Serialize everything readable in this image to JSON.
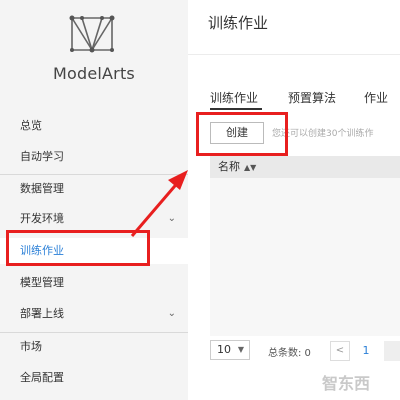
{
  "sidebar": {
    "brand": "ModelArts",
    "items": [
      {
        "label": "总览",
        "chevron": false,
        "active": false
      },
      {
        "label": "自动学习",
        "chevron": false,
        "active": false
      },
      {
        "label": "数据管理",
        "chevron": false,
        "active": false
      },
      {
        "label": "开发环境",
        "chevron": true,
        "active": false
      },
      {
        "label": "训练作业",
        "chevron": false,
        "active": true
      },
      {
        "label": "模型管理",
        "chevron": false,
        "active": false
      },
      {
        "label": "部署上线",
        "chevron": true,
        "active": false
      },
      {
        "label": "市场",
        "chevron": false,
        "active": false
      },
      {
        "label": "全局配置",
        "chevron": false,
        "active": false
      }
    ]
  },
  "main": {
    "title": "训练作业",
    "tabs": [
      "训练作业",
      "预置算法",
      "作业"
    ],
    "active_tab": 0,
    "create_button": "创建",
    "hint": "您还可以创建30个训练作",
    "table": {
      "columns": [
        "名称"
      ]
    },
    "pagination": {
      "page_size": "10",
      "total": "总条数: 0",
      "prev": "<",
      "current": "1"
    }
  },
  "annotation_color": "#e81f1f",
  "watermark": "智东西"
}
